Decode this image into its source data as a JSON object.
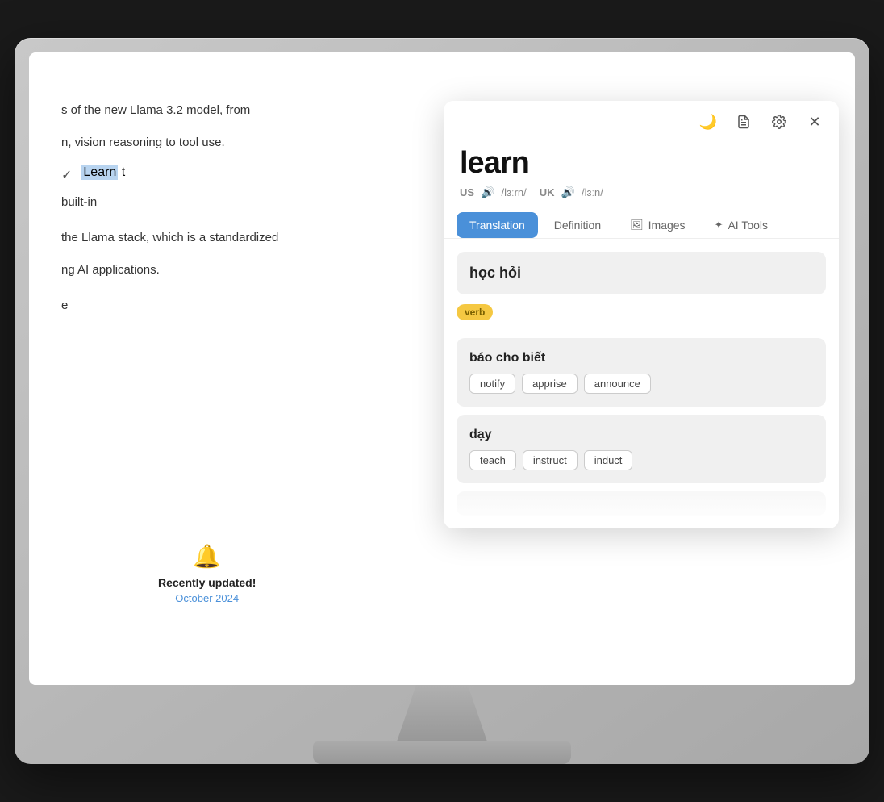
{
  "monitor": {
    "screen": {
      "pageContent": {
        "text1": "s of the new Llama 3.2 model, from",
        "text2": "n, vision reasoning to tool use.",
        "text3": "the Llama stack, which is a standardized",
        "text4": "ng AI applications.",
        "checkText": "Learn t",
        "checkTextHighlight": "Learn",
        "builtIn": "built-in",
        "divider": "e",
        "notification": {
          "label": "Recently updated!",
          "date": "October 2024"
        }
      }
    }
  },
  "dictionary": {
    "header": {
      "moonIcon": "🌙",
      "docIcon": "📄",
      "gearIcon": "⚙",
      "closeIcon": "✕"
    },
    "word": "learn",
    "pronunciations": [
      {
        "region": "US",
        "speakerIcon": "🔊",
        "text": "/lɜːrn/"
      },
      {
        "region": "UK",
        "speakerIcon": "🔊",
        "text": "/lɜːn/"
      }
    ],
    "tabs": [
      {
        "id": "translation",
        "label": "Translation",
        "icon": "",
        "active": true
      },
      {
        "id": "definition",
        "label": "Definition",
        "icon": "",
        "active": false
      },
      {
        "id": "images",
        "label": "Images",
        "icon": "🖼",
        "active": false
      },
      {
        "id": "aitools",
        "label": "AI Tools",
        "icon": "✦",
        "active": false
      }
    ],
    "translation": {
      "mainTranslation": "học hỏi",
      "verbBadge": "verb",
      "entries": [
        {
          "vietnamese": "báo cho biết",
          "synonyms": [
            "notify",
            "apprise",
            "announce"
          ]
        },
        {
          "vietnamese": "dạy",
          "synonyms": [
            "teach",
            "instruct",
            "induct"
          ]
        }
      ]
    }
  }
}
